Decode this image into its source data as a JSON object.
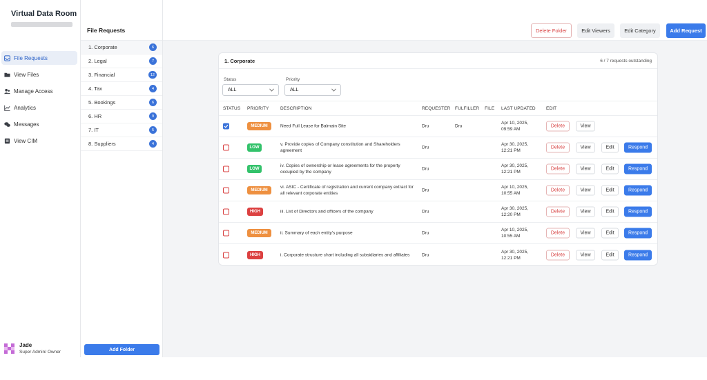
{
  "app": {
    "title": "Virtual Data Room"
  },
  "nav": [
    {
      "label": "File Requests",
      "icon": "inbox-icon",
      "active": true
    },
    {
      "label": "View Files",
      "icon": "folder-icon",
      "active": false
    },
    {
      "label": "Manage Access",
      "icon": "users-icon",
      "active": false
    },
    {
      "label": "Analytics",
      "icon": "chart-icon",
      "active": false
    },
    {
      "label": "Messages",
      "icon": "chat-icon",
      "active": false
    },
    {
      "label": "View CIM",
      "icon": "document-icon",
      "active": false
    }
  ],
  "user": {
    "name": "Jade",
    "role": "Super Admin/ Owner"
  },
  "folders": {
    "title": "File Requests",
    "items": [
      {
        "label": "1. Corporate",
        "count": "6"
      },
      {
        "label": "2. Legal",
        "count": "7"
      },
      {
        "label": "3. Financial",
        "count": "12"
      },
      {
        "label": "4. Tax",
        "count": "4"
      },
      {
        "label": "5. Bookings",
        "count": "6"
      },
      {
        "label": "6. HR",
        "count": "9"
      },
      {
        "label": "7. IT",
        "count": "5"
      },
      {
        "label": "8. Suppliers",
        "count": "4"
      }
    ],
    "add_label": "Add Folder"
  },
  "toolbar": {
    "delete_folder": "Delete Folder",
    "edit_viewers": "Edit Viewers",
    "edit_category": "Edit Category",
    "add_request": "Add Request"
  },
  "card": {
    "title": "1. Corporate",
    "outstanding": "6 / 7 requests outstanding",
    "filters": {
      "status_label": "Status",
      "status_value": "ALL",
      "priority_label": "Priority",
      "priority_value": "ALL"
    },
    "columns": {
      "status": "STATUS",
      "priority": "PRIORITY",
      "description": "DESCRIPTION",
      "requester": "REQUESTER",
      "fulfiller": "FULFILLER",
      "file": "FILE",
      "last_updated": "LAST UPDATED",
      "edit": "EDIT"
    },
    "rows": [
      {
        "checked": true,
        "priority": "MEDIUM",
        "priority_class": "medium",
        "description": "Need Full Lease for Balmain Site",
        "requester": "Dru",
        "fulfiller": "Dru",
        "date": "Apr 10, 2025,",
        "time": "09:59 AM",
        "actions": [
          "Delete",
          "View"
        ]
      },
      {
        "checked": false,
        "priority": "LOW",
        "priority_class": "low",
        "description": "v. Provide copies of Company constitution and Shareholders agreement",
        "requester": "Dru",
        "fulfiller": "",
        "date": "Apr 30, 2025,",
        "time": "12:21 PM",
        "actions": [
          "Delete",
          "View",
          "Edit",
          "Respond"
        ]
      },
      {
        "checked": false,
        "priority": "LOW",
        "priority_class": "low",
        "description": "iv. Copies of ownership or lease agreements for the property occupied by the company",
        "requester": "Dru",
        "fulfiller": "",
        "date": "Apr 30, 2025,",
        "time": "12:21 PM",
        "actions": [
          "Delete",
          "View",
          "Edit",
          "Respond"
        ]
      },
      {
        "checked": false,
        "priority": "MEDIUM",
        "priority_class": "medium",
        "description": "vi. ASIC - Certificate of registration and current company extract for all relevant corporate entities",
        "requester": "Dru",
        "fulfiller": "",
        "date": "Apr 10, 2025,",
        "time": "10:55 AM",
        "actions": [
          "Delete",
          "View",
          "Edit",
          "Respond"
        ]
      },
      {
        "checked": false,
        "priority": "HIGH",
        "priority_class": "high",
        "description": "iii. List of Directors and officers of the company",
        "requester": "Dru",
        "fulfiller": "",
        "date": "Apr 30, 2025,",
        "time": "12:20 PM",
        "actions": [
          "Delete",
          "View",
          "Edit",
          "Respond"
        ]
      },
      {
        "checked": false,
        "priority": "MEDIUM",
        "priority_class": "medium",
        "description": "ii. Summary of each entity's purpose",
        "requester": "Dru",
        "fulfiller": "",
        "date": "Apr 10, 2025,",
        "time": "10:55 AM",
        "actions": [
          "Delete",
          "View",
          "Edit",
          "Respond"
        ]
      },
      {
        "checked": false,
        "priority": "HIGH",
        "priority_class": "high",
        "description": "i. Corporate structure chart including all subsidiaries and affiliates",
        "requester": "Dru",
        "fulfiller": "",
        "date": "Apr 30, 2025,",
        "time": "12:21 PM",
        "actions": [
          "Delete",
          "View",
          "Edit",
          "Respond"
        ]
      }
    ]
  },
  "colors": {
    "accent": "#3b7bea",
    "danger": "#d84141",
    "medium": "#ee9040",
    "low": "#33c26b",
    "high": "#dc4141"
  }
}
